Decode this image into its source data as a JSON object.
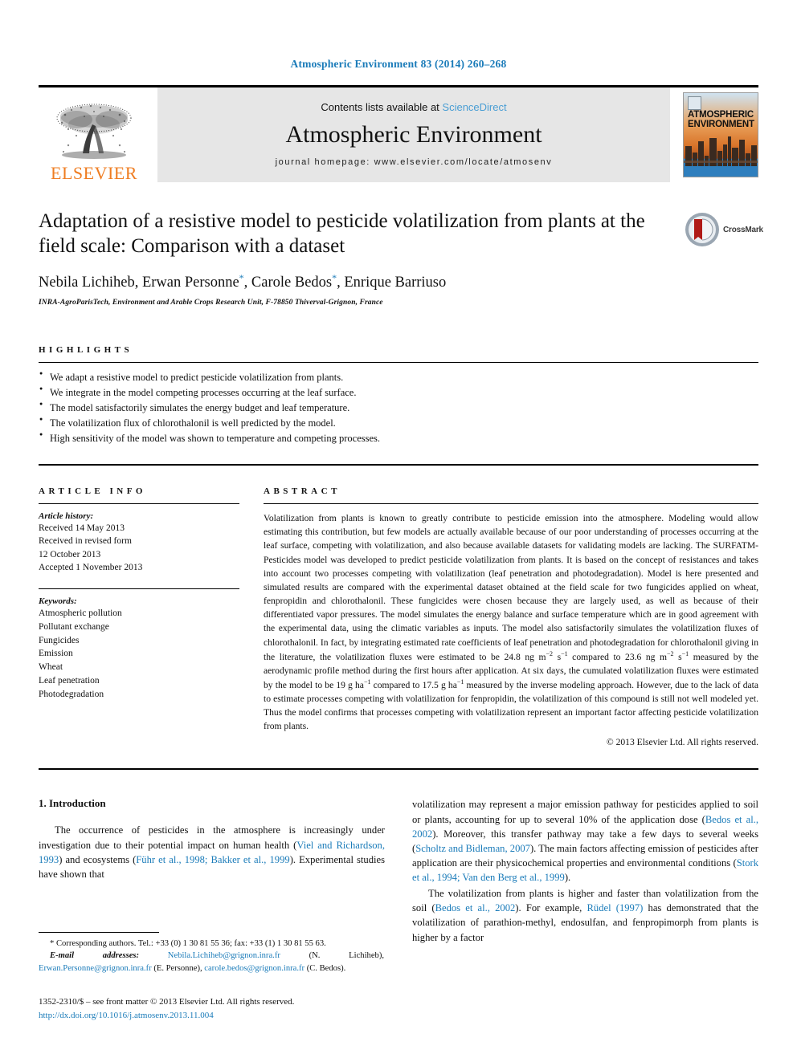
{
  "running_head": "Atmospheric Environment 83 (2014) 260–268",
  "masthead": {
    "publisher_logo_label": "ELSEVIER",
    "contents_prefix": "Contents lists available at ",
    "contents_link": "ScienceDirect",
    "journal_name": "Atmospheric Environment",
    "homepage": "journal homepage: www.elsevier.com/locate/atmosenv",
    "cover_title_line1": "ATMOSPHERIC",
    "cover_title_line2": "ENVIRONMENT"
  },
  "article": {
    "title": "Adaptation of a resistive model to pesticide volatilization from plants at the field scale: Comparison with a dataset",
    "authors_plain": "Nebila Lichiheb, Erwan Personne*, Carole Bedos*, Enrique Barriuso",
    "author_1": "Nebila Lichiheb, Erwan Personne",
    "author_2": ", Carole Bedos",
    "author_3": ", Enrique Barriuso",
    "star": "*",
    "affiliation": "INRA-AgroParisTech, Environment and Arable Crops Research Unit, F-78850 Thiverval-Grignon, France",
    "crossmark_label": "CrossMark"
  },
  "highlights": {
    "heading": "HIGHLIGHTS",
    "items": [
      "We adapt a resistive model to predict pesticide volatilization from plants.",
      "We integrate in the model competing processes occurring at the leaf surface.",
      "The model satisfactorily simulates the energy budget and leaf temperature.",
      "The volatilization flux of chlorothalonil is well predicted by the model.",
      "High sensitivity of the model was shown to temperature and competing processes."
    ]
  },
  "article_info": {
    "heading": "ARTICLE INFO",
    "history_label": "Article history:",
    "history": [
      "Received 14 May 2013",
      "Received in revised form",
      "12 October 2013",
      "Accepted 1 November 2013"
    ],
    "keywords_label": "Keywords:",
    "keywords": [
      "Atmospheric pollution",
      "Pollutant exchange",
      "Fungicides",
      "Emission",
      "Wheat",
      "Leaf penetration",
      "Photodegradation"
    ]
  },
  "abstract": {
    "heading": "ABSTRACT",
    "paragraph_part1": "Volatilization from plants is known to greatly contribute to pesticide emission into the atmosphere. Modeling would allow estimating this contribution, but few models are actually available because of our poor understanding of processes occurring at the leaf surface, competing with volatilization, and also because available datasets for validating models are lacking. The SURFATM-Pesticides model was developed to predict pesticide volatilization from plants. It is based on the concept of resistances and takes into account two processes competing with volatilization (leaf penetration and photodegradation). Model is here presented and simulated results are compared with the experimental dataset obtained at the field scale for two fungicides applied on wheat, fenpropidin and chlorothalonil. These fungicides were chosen because they are largely used, as well as because of their differentiated vapor pressures. The model simulates the energy balance and surface temperature which are in good agreement with the experimental data, using the climatic variables as inputs. The model also satisfactorily simulates the volatilization fluxes of chlorothalonil. In fact, by integrating estimated rate coefficients of leaf penetration and photodegradation for chlorothalonil giving in the literature, the volatilization fluxes were estimated to be 24.8 ng m",
    "unit_sup_1": "−2",
    "paragraph_part2": " s",
    "unit_sup_2": "−1",
    "paragraph_part3": " compared to 23.6 ng m",
    "unit_sup_3": "−2",
    "paragraph_part4": " s",
    "unit_sup_4": "−1",
    "paragraph_part5": " measured by the aerodynamic profile method during the first hours after application. At six days, the cumulated volatilization fluxes were estimated by the model to be 19 g ha",
    "unit_sup_5": "−1",
    "paragraph_part6": " compared to 17.5 g ha",
    "unit_sup_6": "−1",
    "paragraph_part7": " measured by the inverse modeling approach. However, due to the lack of data to estimate processes competing with volatilization for fenpropidin, the volatilization of this compound is still not well modeled yet. Thus the model confirms that processes competing with volatilization represent an important factor affecting pesticide volatilization from plants.",
    "copyright": "© 2013 Elsevier Ltd. All rights reserved."
  },
  "introduction": {
    "section_title": "1. Introduction",
    "left_p1_a": "The occurrence of pesticides in the atmosphere is increasingly under investigation due to their potential impact on human health (",
    "left_cite1": "Viel and Richardson, 1993",
    "left_p1_b": ") and ecosystems (",
    "left_cite2": "Führ et al., 1998; Bakker et al., 1999",
    "left_p1_c": "). Experimental studies have shown that",
    "right_p1_a": "volatilization may represent a major emission pathway for pesticides applied to soil or plants, accounting for up to several 10% of the application dose (",
    "right_cite1": "Bedos et al., 2002",
    "right_p1_b": "). Moreover, this transfer pathway may take a few days to several weeks (",
    "right_cite2": "Scholtz and Bidleman, 2007",
    "right_p1_c": "). The main factors affecting emission of pesticides after application are their physicochemical properties and environmental conditions (",
    "right_cite3": "Stork et al., 1994; Van den Berg et al., 1999",
    "right_p1_d": ").",
    "right_p2_a": "The volatilization from plants is higher and faster than volatilization from the soil (",
    "right_cite4": "Bedos et al., 2002",
    "right_p2_b": "). For example, ",
    "right_cite5": "Rüdel (1997)",
    "right_p2_c": " has demonstrated that the volatilization of parathion-methyl, endosulfan, and fenpropimorph from plants is higher by a factor"
  },
  "footnotes": {
    "corresponding_a": "* Corresponding authors. Tel.: +33 (0) 1 30 81 55 36; fax: +33 (1) 1 30 81 55 63.",
    "email_label": "E-mail addresses:",
    "email_1": "Nebila.Lichiheb@grignon.inra.fr",
    "email_1_name": " (N. Lichiheb), ",
    "email_2": "Erwan.Personne@grignon.inra.fr",
    "email_2_name": " (E. Personne), ",
    "email_3": "carole.bedos@grignon.inra.fr",
    "email_3_name": " (C. Bedos).",
    "issn_line": "1352-2310/$ – see front matter © 2013 Elsevier Ltd. All rights reserved.",
    "doi_line": "http://dx.doi.org/10.1016/j.atmosenv.2013.11.004"
  },
  "colors": {
    "link_blue": "#1a7bb9",
    "sciencedirect_blue": "#4a9ed4",
    "elsevier_orange": "#ef7d22",
    "band_gray": "#e6e6e6"
  }
}
